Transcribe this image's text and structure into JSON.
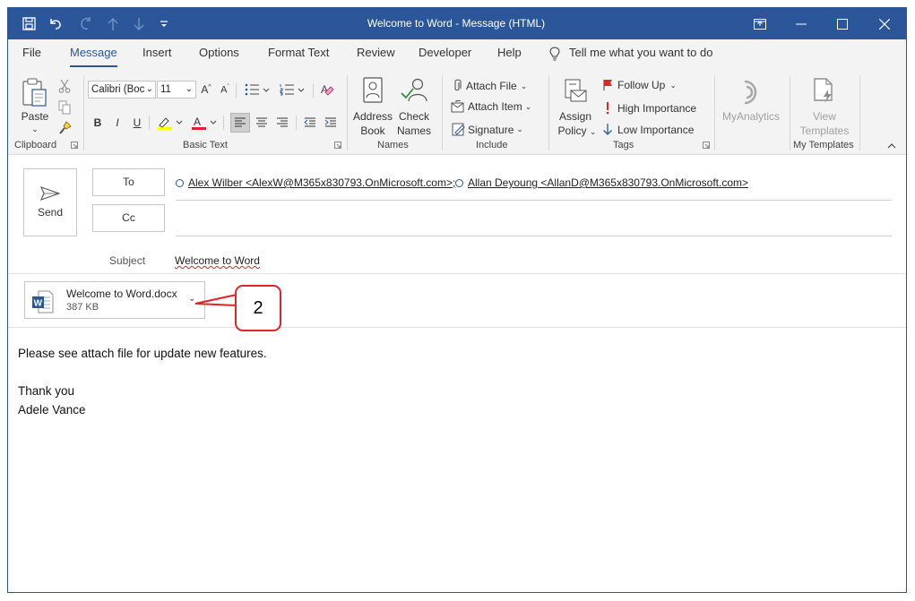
{
  "window": {
    "title": "Welcome to Word  -  Message (HTML)"
  },
  "menu": {
    "tabs": [
      "File",
      "Message",
      "Insert",
      "Options",
      "Format Text",
      "Review",
      "Developer",
      "Help"
    ],
    "active_tab": "Message",
    "tell_me": "Tell me what you want to do"
  },
  "ribbon": {
    "clipboard": {
      "paste": "Paste",
      "group": "Clipboard"
    },
    "basic_text": {
      "font": "Calibri (Boc",
      "size": "11",
      "bold": "B",
      "italic": "I",
      "underline": "U",
      "group": "Basic Text"
    },
    "names": {
      "address": "Address",
      "book": "Book",
      "check": "Check",
      "names_label": "Names",
      "group": "Names"
    },
    "include": {
      "attach_file": "Attach File",
      "attach_item": "Attach Item",
      "signature": "Signature",
      "group": "Include"
    },
    "tags": {
      "assign": "Assign",
      "policy": "Policy",
      "follow_up": "Follow Up",
      "high": "High Importance",
      "low": "Low Importance",
      "group": "Tags"
    },
    "myanalytics": {
      "label": "MyAnalytics"
    },
    "templates": {
      "view": "View",
      "templates": "Templates",
      "group": "My Templates"
    }
  },
  "compose": {
    "send": "Send",
    "to_label": "To",
    "cc_label": "Cc",
    "subject_label": "Subject",
    "subject": "Welcome to Word",
    "recipients": [
      "Alex Wilber <AlexW@M365x830793.OnMicrosoft.com>;",
      "Allan Deyoung <AllanD@M365x830793.OnMicrosoft.com>"
    ]
  },
  "attachment": {
    "name": "Welcome to Word.docx",
    "size": "387 KB"
  },
  "callout": {
    "number": "2"
  },
  "body": {
    "line1": "Please see attach file for update new features.",
    "line2": "Thank you",
    "line3": "Adele Vance"
  },
  "colors": {
    "accent": "#2b579a",
    "callout": "#e0242a",
    "word_icon": "#2b579a"
  }
}
